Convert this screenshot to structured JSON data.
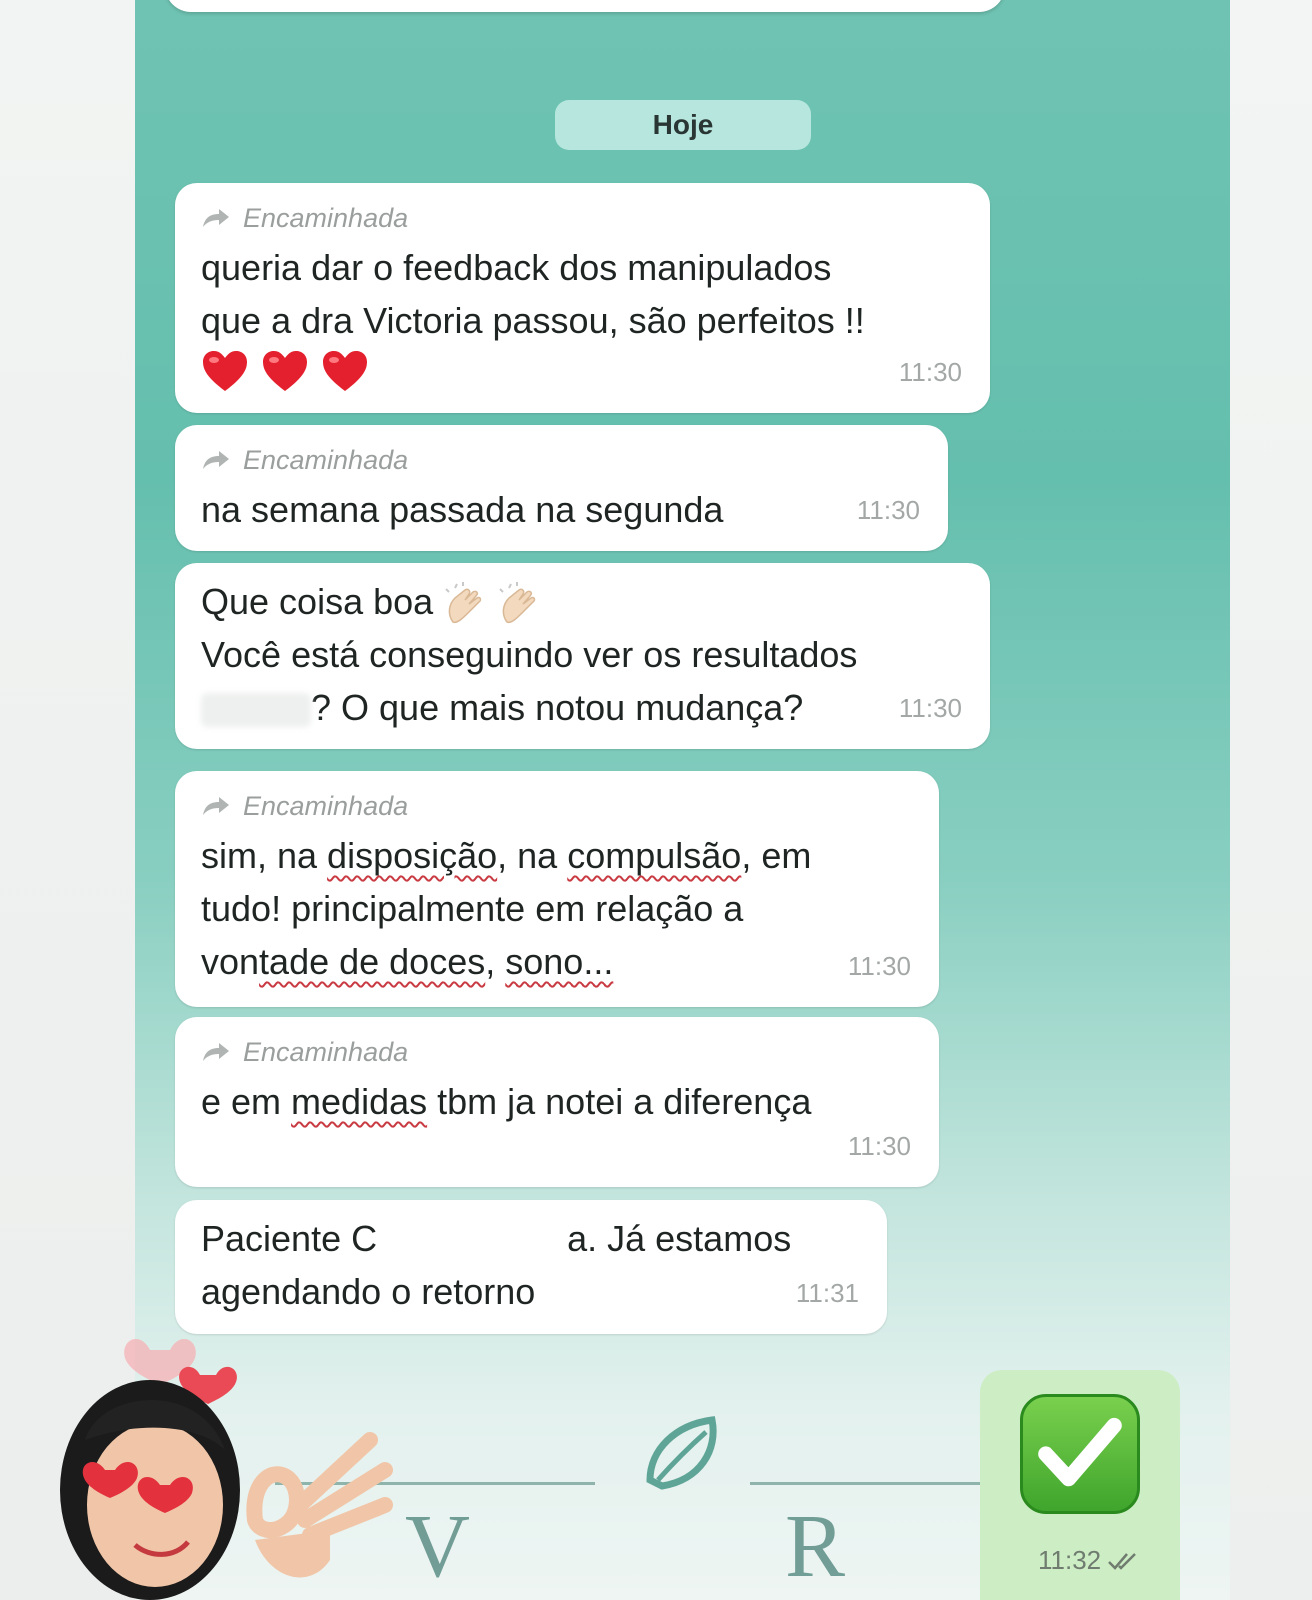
{
  "chat": {
    "date_label": "Hoje",
    "forward_label": "Encaminhada",
    "messages": [
      {
        "forwarded": true,
        "lines": "queria dar o feedback dos manipulados\nque a dra Victoria passou, são perfeitos !!",
        "emoji": "❤️❤️❤️",
        "time": "11:30"
      },
      {
        "forwarded": true,
        "text": "na semana passada na segunda",
        "time": "11:30"
      },
      {
        "forwarded": false,
        "line1": "Que coisa boa",
        "emoji": "👏🏻👏🏻",
        "line2": "Você está conseguindo ver os resultados",
        "line3": "? O que mais notou mudança?",
        "time": "11:30"
      },
      {
        "forwarded": true,
        "text": "sim, na disposição, na compulsão, em tudo! principalmente em relação a vontade de doces, sono...",
        "parts": [
          "sim, na ",
          "disposição",
          ", na ",
          "compulsão",
          ", em",
          "tudo! principalmente em relação a",
          "von",
          "tade de doces",
          ", ",
          "sono..."
        ],
        "time": "11:30"
      },
      {
        "forwarded": true,
        "text": "e em medidas tbm ja notei a diferença",
        "parts": [
          "e em ",
          "medidas",
          " tbm ja notei a diferença"
        ],
        "time": "11:30"
      },
      {
        "forwarded": false,
        "part1": "Paciente C",
        "part2": "a. Já estamos",
        "line2": "agendando o retorno",
        "time": "11:31"
      }
    ],
    "sent": {
      "emoji": "✅",
      "time": "11:32",
      "status": "read"
    }
  },
  "logo": {
    "left_letter": "V",
    "right_letter": "R"
  },
  "colors": {
    "chat_bg_top": "#6fc3b2",
    "bubble": "#ffffff",
    "date_chip": "#b6e6de",
    "sent_bubble": "#cdeec4",
    "underline": "#c93b43"
  },
  "icons": [
    "forward-arrow-icon",
    "heart-icon",
    "clapping-hands-icon",
    "leaf-logo-icon",
    "check-mark-icon",
    "double-check-icon"
  ]
}
